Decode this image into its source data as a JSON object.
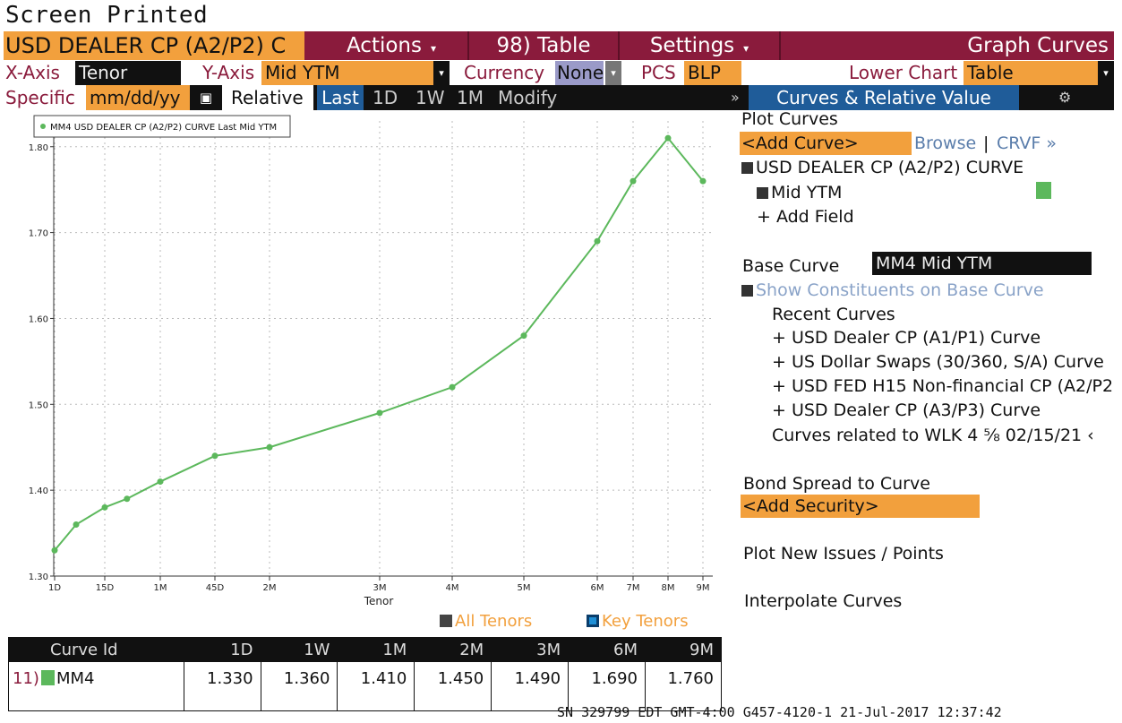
{
  "screen_title": "Screen Printed",
  "header": {
    "security": "USD DEALER CP (A2/P2) C",
    "actions": "Actions",
    "table": "98) Table",
    "settings": "Settings",
    "panel_title": "Graph Curves"
  },
  "options": {
    "x_axis_label": "X-Axis",
    "x_axis_value": "Tenor",
    "y_axis_label": "Y-Axis",
    "y_axis_value": "Mid YTM",
    "currency_label": "Currency",
    "currency_value": "None",
    "pcs_label": "PCS",
    "pcs_value": "BLP",
    "lower_chart_label": "Lower Chart",
    "lower_chart_value": "Table"
  },
  "toolbar": {
    "specific_label": "Specific",
    "date_placeholder": "mm/dd/yy",
    "relative_label": "Relative",
    "last": "Last",
    "d1": "1D",
    "w1": "1W",
    "m1": "1M",
    "modify": "Modify",
    "chevrons": "»",
    "panel_tab": "Curves & Relative Value",
    "gear": "⚙"
  },
  "right_panel": {
    "plot_curves": "Plot Curves",
    "add_curve": "<Add Curve>",
    "browse": "Browse",
    "divider": "|",
    "crvf": "CRVF »",
    "curve_name": "USD DEALER CP (A2/P2) CURVE",
    "field_name": "Mid YTM",
    "add_field": "+ Add Field",
    "base_curve_label": "Base Curve",
    "base_curve_value": "MM4 Mid YTM",
    "show_constituents": "Show Constituents on Base Curve",
    "recent_curves": "Recent Curves",
    "recent": [
      "+ USD Dealer CP (A1/P1) Curve",
      "+ US Dollar Swaps (30/360, S/A) Curve",
      "+ USD FED H15 Non-financial CP (A2/P2",
      "+ USD Dealer CP (A3/P3) Curve"
    ],
    "related": "Curves related to WLK 4 ⅝ 02/15/21 ‹",
    "bond_spread": "Bond Spread to Curve",
    "add_security": "<Add Security>",
    "plot_new_issues": "Plot New Issues / Points",
    "interpolate": "Interpolate Curves"
  },
  "chart_toggles": {
    "all_tenors": "All Tenors",
    "key_tenors": "Key Tenors"
  },
  "chart_data": {
    "type": "line",
    "legend": "MM4 USD DEALER CP (A2/P2) CURVE Last Mid YTM",
    "xlabel": "Tenor",
    "ylim": [
      1.3,
      1.83
    ],
    "yticks": [
      "1.30",
      "1.40",
      "1.50",
      "1.60",
      "1.70",
      "1.80"
    ],
    "xticks": [
      "1D",
      "15D",
      "1M",
      "45D",
      "2M",
      "3M",
      "4M",
      "5M",
      "6M",
      "7M",
      "8M",
      "9M"
    ],
    "series": [
      {
        "color": "#5cb85c",
        "points": [
          {
            "tenor_days": 1,
            "y": 1.33
          },
          {
            "tenor_days": 7,
            "y": 1.36
          },
          {
            "tenor_days": 15,
            "y": 1.38
          },
          {
            "tenor_days": 21,
            "y": 1.39
          },
          {
            "tenor_days": 30,
            "y": 1.41
          },
          {
            "tenor_days": 45,
            "y": 1.44
          },
          {
            "tenor_days": 60,
            "y": 1.45
          },
          {
            "tenor_days": 90,
            "y": 1.49
          },
          {
            "tenor_days": 120,
            "y": 1.52
          },
          {
            "tenor_days": 150,
            "y": 1.58
          },
          {
            "tenor_days": 180,
            "y": 1.69
          },
          {
            "tenor_days": 210,
            "y": 1.76
          },
          {
            "tenor_days": 240,
            "y": 1.81
          },
          {
            "tenor_days": 270,
            "y": 1.76
          }
        ]
      }
    ]
  },
  "table": {
    "headers": [
      "Curve Id",
      "1D",
      "1W",
      "1M",
      "2M",
      "3M",
      "6M",
      "9M"
    ],
    "row_num": "11)",
    "row_id": "MM4",
    "row_values": [
      "1.330",
      "1.360",
      "1.410",
      "1.450",
      "1.490",
      "1.690",
      "1.760"
    ]
  },
  "footer": "SN 329799 EDT  GMT-4:00 G457-4120-1 21-Jul-2017 12:37:42"
}
